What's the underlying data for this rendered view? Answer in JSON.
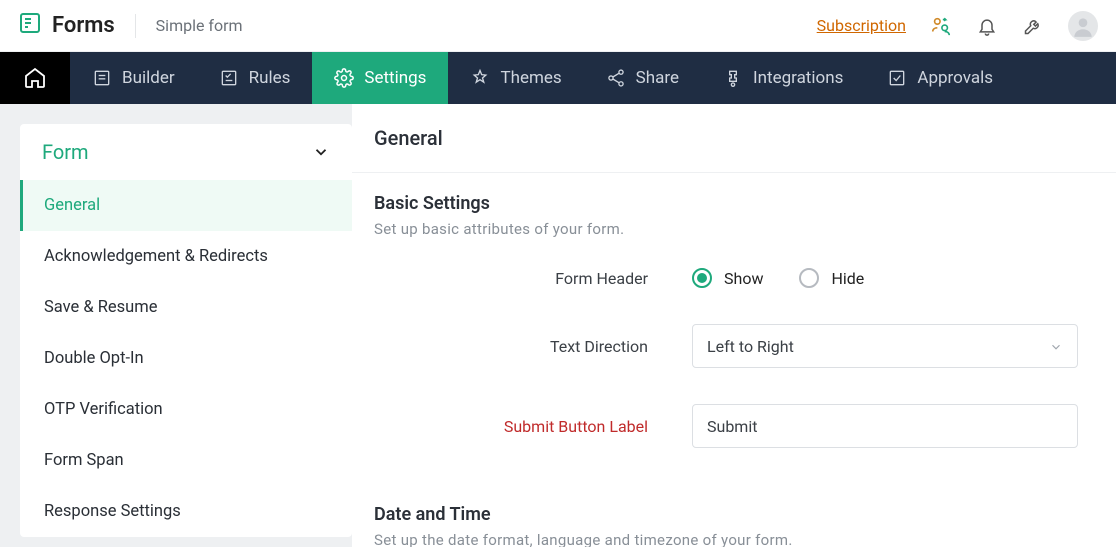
{
  "header": {
    "brand": "Forms",
    "form_title": "Simple form",
    "subscription": "Subscription"
  },
  "nav": {
    "builder": "Builder",
    "rules": "Rules",
    "settings": "Settings",
    "themes": "Themes",
    "share": "Share",
    "integrations": "Integrations",
    "approvals": "Approvals"
  },
  "sidebar": {
    "section_title": "Form",
    "items": [
      "General",
      "Acknowledgement & Redirects",
      "Save & Resume",
      "Double Opt-In",
      "OTP Verification",
      "Form Span",
      "Response Settings"
    ]
  },
  "main": {
    "page_title": "General",
    "basic": {
      "title": "Basic Settings",
      "subtitle": "Set up basic attributes of your form.",
      "form_header_label": "Form Header",
      "show": "Show",
      "hide": "Hide",
      "text_direction_label": "Text Direction",
      "text_direction_value": "Left to Right",
      "submit_button_label": "Submit Button Label",
      "submit_button_value": "Submit"
    },
    "datetime": {
      "title": "Date and Time",
      "subtitle": "Set up the date format, language and timezone of your form."
    }
  }
}
